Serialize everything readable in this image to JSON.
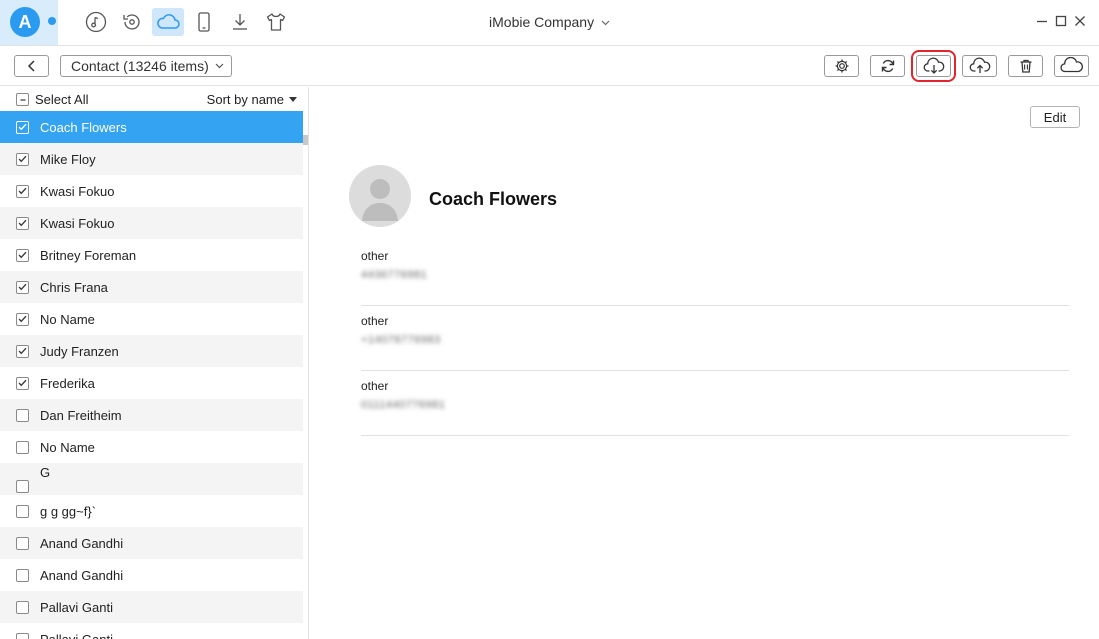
{
  "app": {
    "logo_letter": "A",
    "device_name": "iMobie Company",
    "accent_color": "#33a3f2",
    "highlight_color": "#e0262c"
  },
  "nav_tabs": [
    {
      "name": "itunes-library",
      "icon": "music-note-icon"
    },
    {
      "name": "backup-restore",
      "icon": "history-icon"
    },
    {
      "name": "icloud",
      "icon": "cloud-icon",
      "active": true
    },
    {
      "name": "device",
      "icon": "phone-icon"
    },
    {
      "name": "downloader",
      "icon": "download-icon"
    },
    {
      "name": "skins",
      "icon": "tshirt-icon"
    }
  ],
  "toolbar": {
    "category_label": "Contact (13246 items)",
    "buttons": [
      "gear-icon",
      "refresh-icon",
      "cloud-download-icon",
      "cloud-upload-icon",
      "trash-icon",
      "cloud-sync-icon"
    ]
  },
  "list": {
    "select_all": "Select All",
    "sort_label": "Sort by name",
    "items": [
      {
        "label": "Coach Flowers",
        "checked": true,
        "selected": true
      },
      {
        "label": "Mike Floy",
        "checked": true
      },
      {
        "label": "Kwasi Fokuo",
        "checked": true
      },
      {
        "label": "Kwasi Fokuo",
        "checked": true
      },
      {
        "label": "Britney Foreman",
        "checked": true
      },
      {
        "label": "Chris Frana",
        "checked": true
      },
      {
        "label": "No Name",
        "checked": true
      },
      {
        "label": "Judy Franzen",
        "checked": true
      },
      {
        "label": "Frederika",
        "checked": true
      },
      {
        "label": "Dan Freitheim",
        "checked": false
      },
      {
        "label": "No Name",
        "checked": false
      },
      {
        "label": "G",
        "checked": false
      },
      {
        "label": "g g gg~f}`",
        "checked": false
      },
      {
        "label": "Anand Gandhi",
        "checked": false
      },
      {
        "label": "Anand Gandhi",
        "checked": false
      },
      {
        "label": "Pallavi Ganti",
        "checked": false
      },
      {
        "label": "Pallavi Ganti",
        "checked": false
      }
    ]
  },
  "detail": {
    "edit_label": "Edit",
    "name": "Coach Flowers",
    "fields": [
      {
        "label": "other",
        "value": "4436776981"
      },
      {
        "label": "other",
        "value": "+14078776983"
      },
      {
        "label": "other",
        "value": "0111440776981"
      }
    ]
  }
}
